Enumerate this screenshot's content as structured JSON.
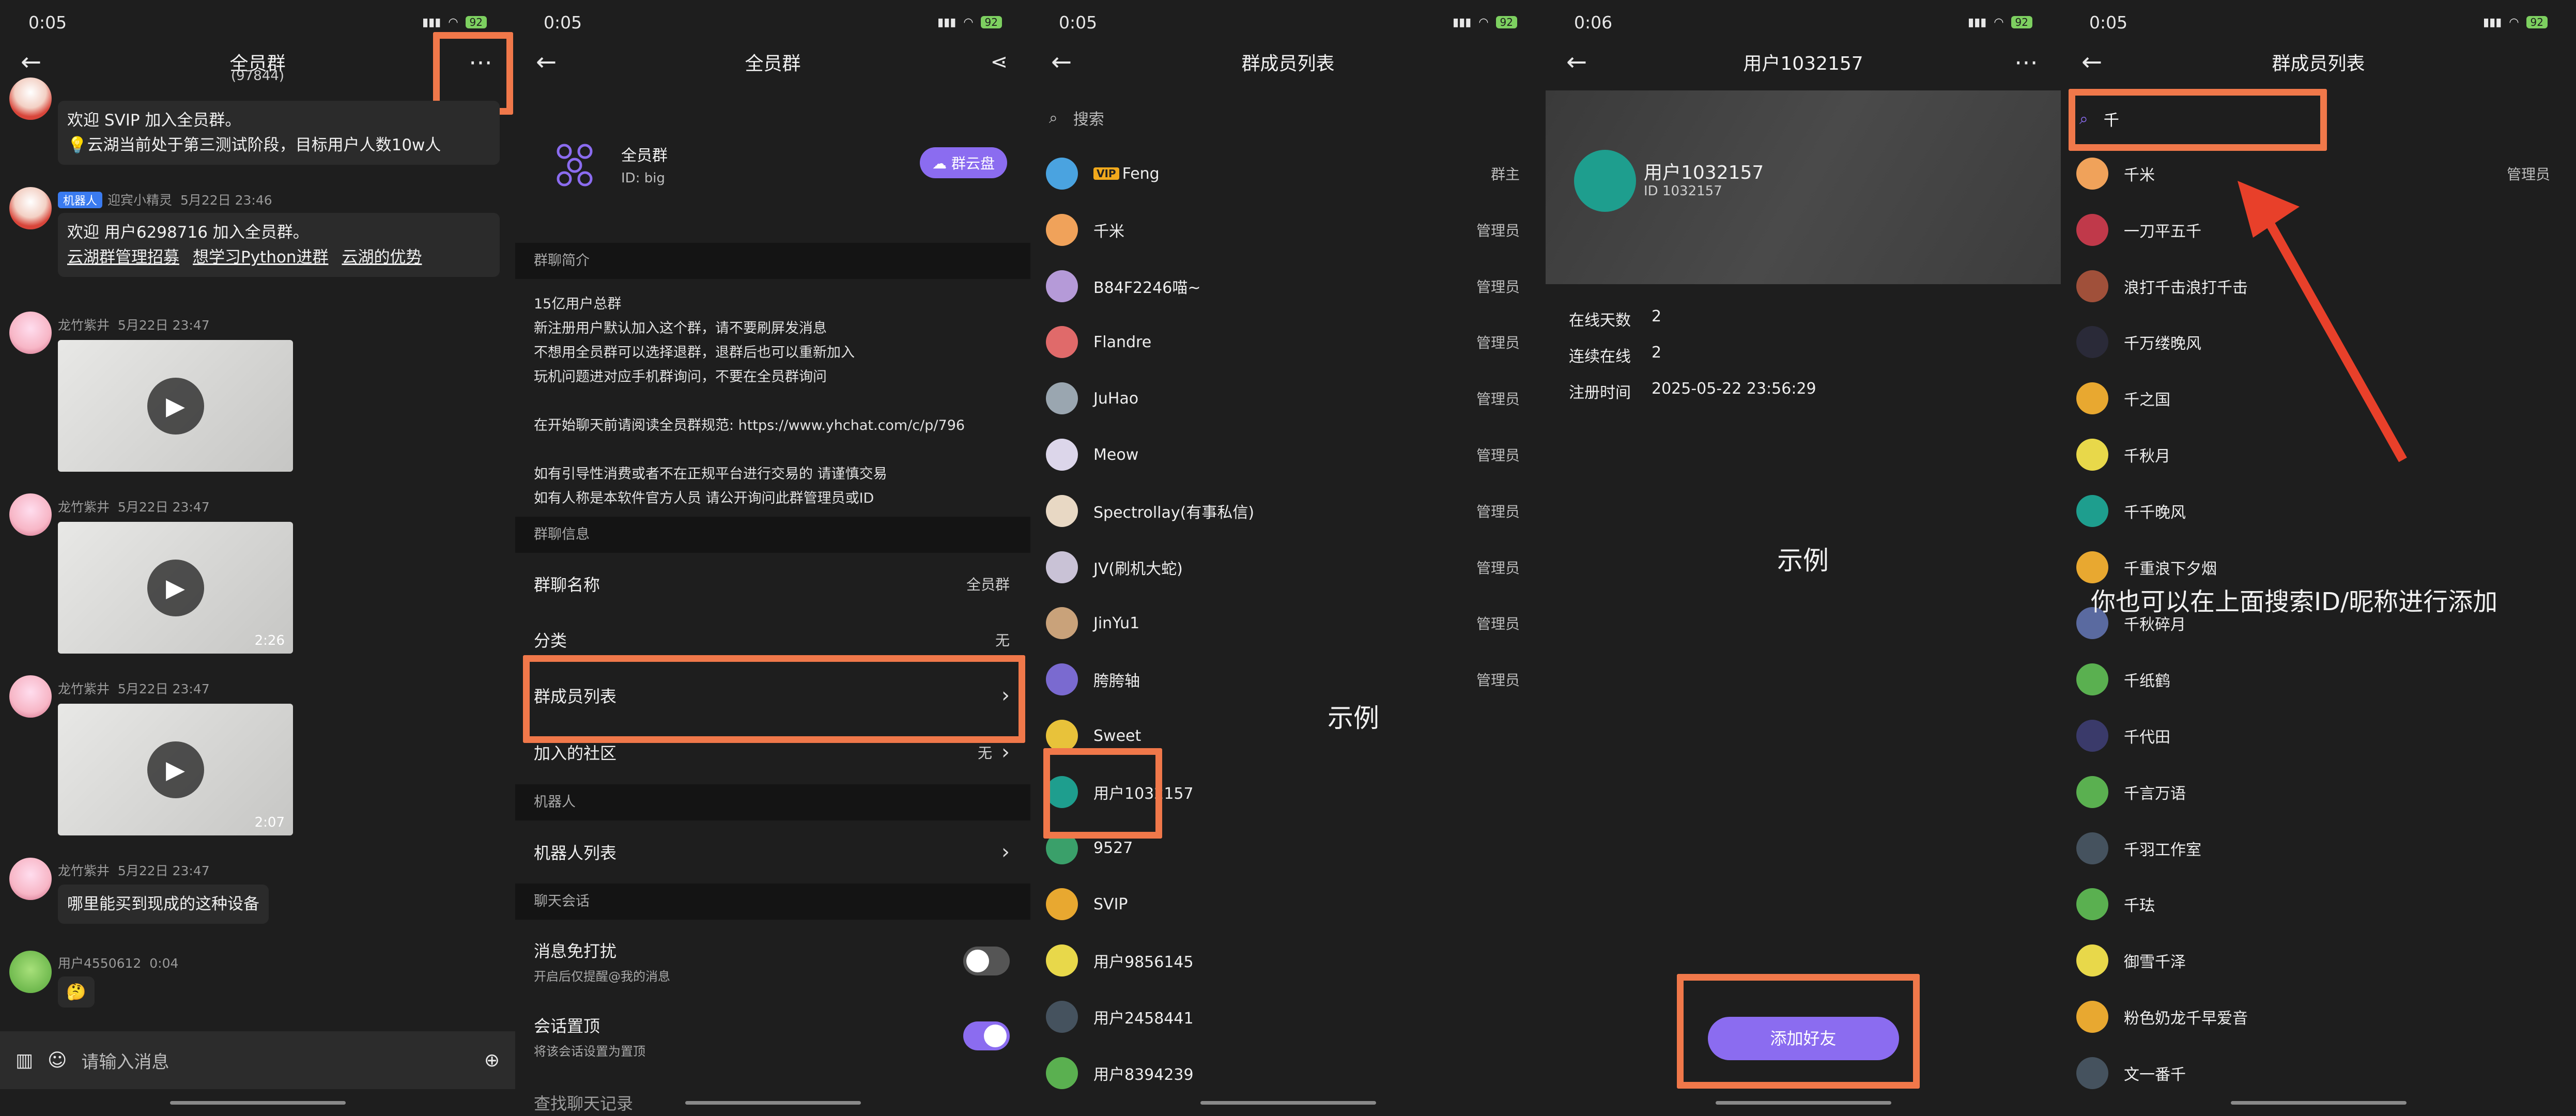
{
  "status_times": [
    "0:05",
    "0:05",
    "0:05",
    "0:06",
    "0:05"
  ],
  "battery": "92",
  "panel1": {
    "title": "全员群",
    "count": "(97844)",
    "more_icon": "more-icon",
    "m1": {
      "text1": "欢迎 SVIP 加入全员群。",
      "text2": "💡云湖当前处于第三测试阶段，目标用户人数10w人"
    },
    "m2": {
      "tag": "机器人",
      "sender": "迎宾小精灵",
      "time": "5月22日 23:46",
      "text": "欢迎 用户6298716 加入全员群。",
      "links": [
        "云湖群管理招募",
        "想学习Python进群",
        "云湖的优势"
      ]
    },
    "v1": {
      "sender": "龙竹紫井",
      "time": "5月22日 23:47",
      "dur": ""
    },
    "v2": {
      "sender": "龙竹紫井",
      "time": "5月22日 23:47",
      "dur": "2:26"
    },
    "v3": {
      "sender": "龙竹紫井",
      "time": "5月22日 23:47",
      "dur": "2:07"
    },
    "m3": {
      "sender": "龙竹紫井",
      "time": "5月22日 23:47",
      "text": "哪里能买到现成的这种设备"
    },
    "m4": {
      "sender": "用户4550612",
      "time": "0:04",
      "text": "🤔"
    },
    "input_placeholder": "请输入消息"
  },
  "panel2": {
    "title": "全员群",
    "group_name": "全员群",
    "group_id": "ID: big",
    "cloud_btn": "群云盘",
    "sec_intro": "群聊简介",
    "intro": "15亿用户总群\n新注册用户默认加入这个群，请不要刷屏发消息\n不想用全员群可以选择退群，退群后也可以重新加入\n玩机问题进对应手机群询问，不要在全员群询问\n\n在开始聊天前请阅读全员群规范: https://www.yhchat.com/c/p/796\n\n如有引导性消费或者不在正规平台进行交易的 请谨慎交易\n如有人称是本软件官方人员 请公开询问此群管理员或ID",
    "sec_info": "群聊信息",
    "r_name": "群聊名称",
    "r_name_v": "全员群",
    "r_cat": "分类",
    "r_cat_v": "无",
    "r_members": "群成员列表",
    "r_comm": "加入的社区",
    "r_comm_v": "无",
    "sec_bot": "机器人",
    "r_bots": "机器人列表",
    "sec_chat": "聊天会话",
    "r_mute": "消息免打扰",
    "r_mute_s": "开启后仅提醒@我的消息",
    "r_pin": "会话置顶",
    "r_pin_s": "将该会话设置为置顶",
    "r_more": "查找聊天记录"
  },
  "panel3": {
    "title": "群成员列表",
    "search_placeholder": "搜索",
    "members": [
      {
        "name": "Feng",
        "role": "群主",
        "vip": "VIP",
        "color": "#4aa3e0"
      },
      {
        "name": "千米",
        "role": "管理员",
        "color": "#f0a25a"
      },
      {
        "name": "B84F2246喵~",
        "role": "管理员",
        "color": "#b59ad8"
      },
      {
        "name": "Flandre",
        "role": "管理员",
        "color": "#e06a6a"
      },
      {
        "name": "JuHao",
        "role": "管理员",
        "color": "#9aa6b0"
      },
      {
        "name": "Meow",
        "role": "管理员",
        "color": "#dcd6ea"
      },
      {
        "name": "Spectrollay(有事私信)",
        "role": "管理员",
        "color": "#e8d8c4"
      },
      {
        "name": "JV(刷机大蛇)",
        "role": "管理员",
        "color": "#c9c2d6"
      },
      {
        "name": "JinYu1",
        "role": "管理员",
        "color": "#c9a27a"
      },
      {
        "name": "胯胯轴",
        "role": "管理员",
        "color": "#7a6ad0"
      },
      {
        "name": "Sweet",
        "role": "",
        "color": "#e8c23a"
      },
      {
        "name": "用户1032157",
        "role": "",
        "color": "#1e9e8e"
      },
      {
        "name": "9527",
        "role": "",
        "color": "#3aa06a"
      },
      {
        "name": "SVIP",
        "role": "",
        "color": "#e8a830"
      },
      {
        "name": "用户9856145",
        "role": "",
        "color": "#e8d84a"
      },
      {
        "name": "用户2458441",
        "role": "",
        "color": "#45525e"
      },
      {
        "name": "用户8394239",
        "role": "",
        "color": "#5ab050"
      }
    ],
    "annot": "示例"
  },
  "panel4": {
    "title": "用户1032157",
    "name": "用户1032157",
    "id": "ID 1032157",
    "online_days_k": "在线天数",
    "online_days_v": "2",
    "streak_k": "连续在线",
    "streak_v": "2",
    "reg_k": "注册时间",
    "reg_v": "2025-05-22 23:56:29",
    "annot": "示例",
    "add_btn": "添加好友"
  },
  "panel5": {
    "title": "群成员列表",
    "search_value": "千",
    "members": [
      {
        "name": "千米",
        "role": "管理员",
        "color": "#f0a25a"
      },
      {
        "name": "一刀平五千",
        "role": "",
        "color": "#c0394a"
      },
      {
        "name": "浪打千击浪打千击",
        "role": "",
        "color": "#a0503a"
      },
      {
        "name": "千万缕晚风",
        "role": "",
        "color": "#2a2a38"
      },
      {
        "name": "千之国",
        "role": "",
        "color": "#e8a830"
      },
      {
        "name": "千秋月",
        "role": "",
        "color": "#e8d84a"
      },
      {
        "name": "千千晚风",
        "role": "",
        "color": "#1e9e8e"
      },
      {
        "name": "千重浪下夕烟",
        "role": "",
        "color": "#e8a830"
      },
      {
        "name": "千秋碎月",
        "role": "",
        "color": "#5a6aa0"
      },
      {
        "name": "千纸鹤",
        "role": "",
        "color": "#5ab050"
      },
      {
        "name": "千代田",
        "role": "",
        "color": "#3a3a6a"
      },
      {
        "name": "千言万语",
        "role": "",
        "color": "#5ab050"
      },
      {
        "name": "千羽工作室",
        "role": "",
        "color": "#45525e"
      },
      {
        "name": "千珐",
        "role": "",
        "color": "#5ab050"
      },
      {
        "name": "御雪千泽",
        "role": "",
        "color": "#e8d84a"
      },
      {
        "name": "粉色奶龙千早爱音",
        "role": "",
        "color": "#e8a830"
      },
      {
        "name": "文一番千",
        "role": "",
        "color": "#45525e"
      }
    ],
    "annot": "你也可以在上面搜索ID/昵称进行添加"
  }
}
